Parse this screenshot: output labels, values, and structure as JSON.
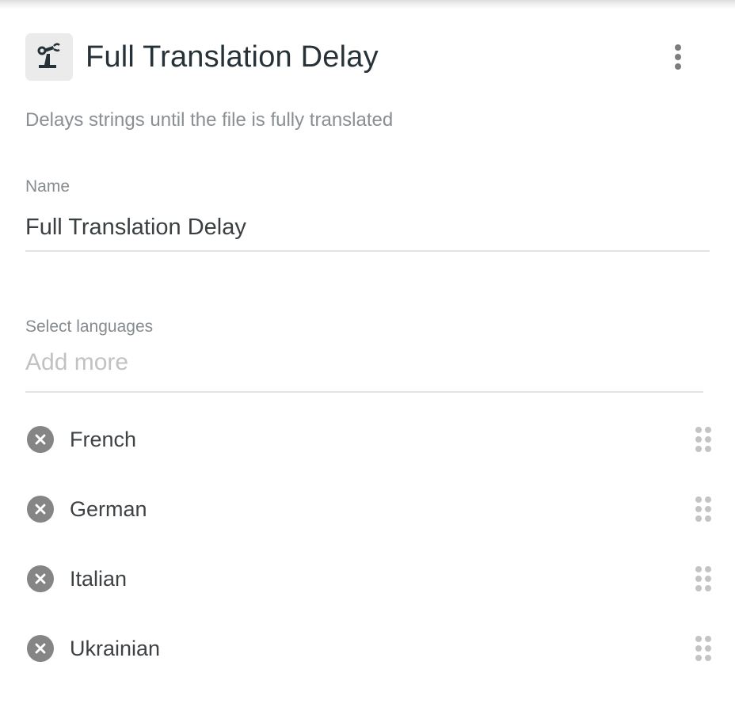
{
  "header": {
    "icon": "robot-arm-icon",
    "title": "Full Translation Delay",
    "menu_icon": "more-vertical-icon"
  },
  "description": "Delays strings until the file is fully translated",
  "name_field": {
    "label": "Name",
    "value": "Full Translation Delay"
  },
  "languages_field": {
    "label": "Select languages",
    "placeholder": "Add more"
  },
  "languages": [
    {
      "name": "French",
      "remove_icon": "remove-circle-icon",
      "handle_icon": "drag-handle-icon"
    },
    {
      "name": "German",
      "remove_icon": "remove-circle-icon",
      "handle_icon": "drag-handle-icon"
    },
    {
      "name": "Italian",
      "remove_icon": "remove-circle-icon",
      "handle_icon": "drag-handle-icon"
    },
    {
      "name": "Ukrainian",
      "remove_icon": "remove-circle-icon",
      "handle_icon": "drag-handle-icon"
    }
  ],
  "colors": {
    "title": "#263238",
    "muted_text": "#8a8f93",
    "placeholder": "#c2c2c2",
    "remove_icon_bg": "#858585",
    "drag_dots": "#c4c4c4"
  }
}
